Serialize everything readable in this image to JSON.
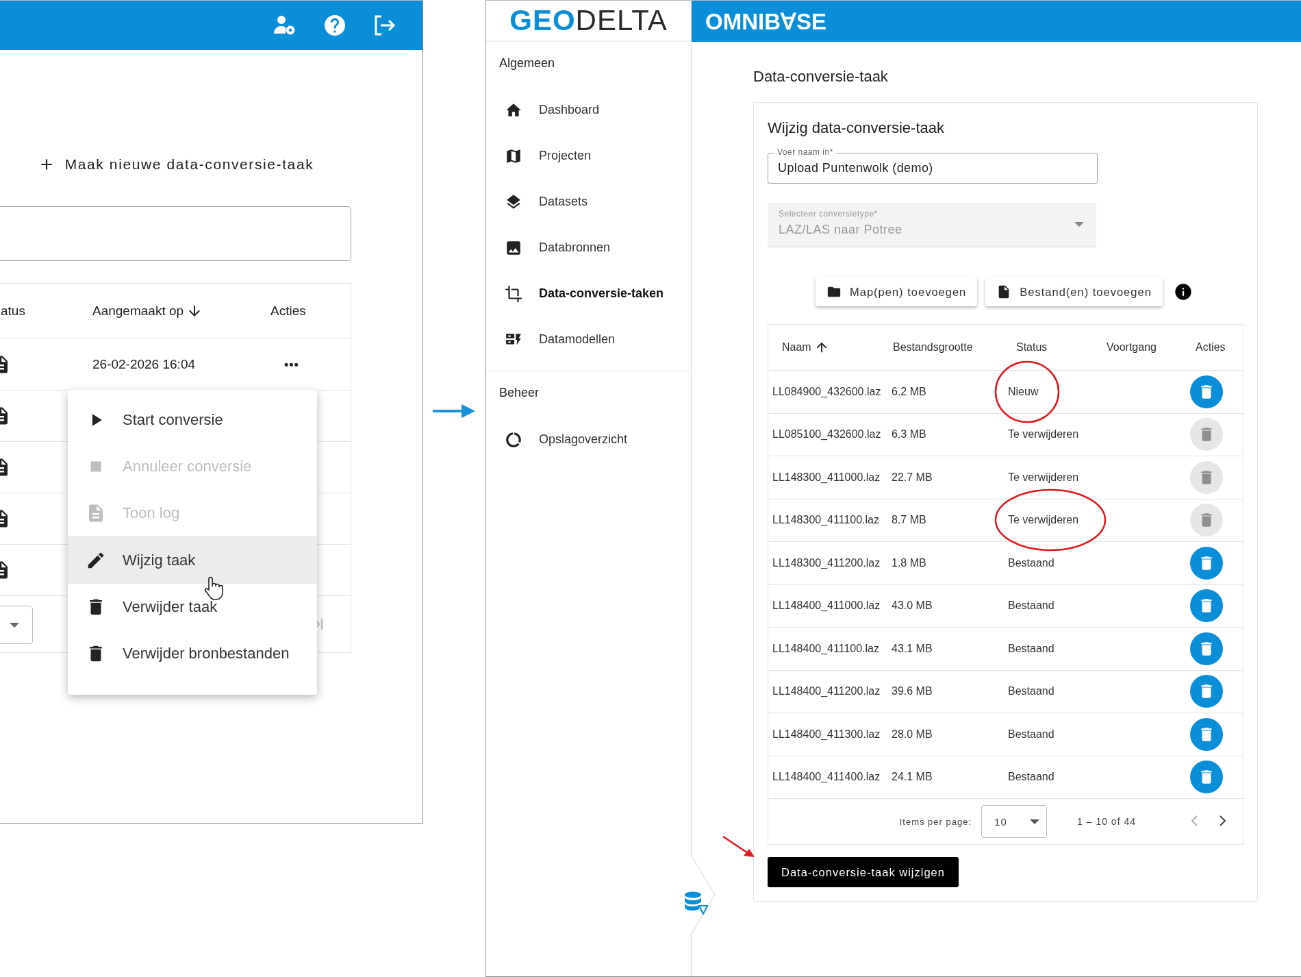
{
  "task_list_screen": {
    "new_task_button": "Maak nieuwe data-conversie-taak",
    "columns": [
      {
        "label": "atus"
      },
      {
        "label": "Aangemaakt op"
      },
      {
        "label": "Acties"
      }
    ],
    "rows": [
      {
        "kind": "full",
        "created": "26-02-2026 16:04",
        "actions": "•••"
      },
      {
        "kind": "covered"
      },
      {
        "kind": "covered"
      },
      {
        "kind": "covered"
      },
      {
        "kind": "covered"
      }
    ],
    "menu": {
      "items": [
        {
          "label": "Start conversie",
          "disabled": false,
          "hovered": false
        },
        {
          "label": "Annuleer conversie",
          "disabled": true,
          "hovered": false
        },
        {
          "label": "Toon log",
          "disabled": true,
          "hovered": false,
          "divider_after": true
        },
        {
          "label": "Wijzig taak",
          "disabled": false,
          "hovered": true
        },
        {
          "label": "Verwijder taak",
          "disabled": false,
          "hovered": false
        },
        {
          "label": "Verwijder bronbestanden",
          "disabled": false,
          "hovered": false
        }
      ]
    }
  },
  "edit_screen": {
    "brand": {
      "logo_part_1": "GEO",
      "logo_part_2": "DELTA",
      "product": "OMNIB∀SE"
    },
    "sidebar": {
      "sections": [
        {
          "title": "Algemeen",
          "items": [
            {
              "label": "Dashboard",
              "selected": false
            },
            {
              "label": "Projecten",
              "selected": false
            },
            {
              "label": "Datasets",
              "selected": false
            },
            {
              "label": "Databronnen",
              "selected": false
            },
            {
              "label": "Data-conversie-taken",
              "selected": true
            },
            {
              "label": "Datamodellen",
              "selected": false
            }
          ]
        },
        {
          "title": "Beheer",
          "items": [
            {
              "label": "Opslagoverzicht",
              "selected": false
            }
          ]
        }
      ]
    },
    "page_title": "Data-conversie-taak",
    "form": {
      "title": "Wijzig data-conversie-taak",
      "fields": [
        {
          "label": "Voer naam in*",
          "value": "Upload Puntenwolk (demo)",
          "disabled": false
        },
        {
          "label": "Selecteer conversietype*",
          "value": "LAZ/LAS naar Potree",
          "disabled": true
        }
      ],
      "buttons": [
        {
          "label": "Map(pen) toevoegen"
        },
        {
          "label": "Bestand(en) toevoegen"
        }
      ]
    },
    "files": {
      "columns": [
        {
          "label": "Naam"
        },
        {
          "label": "Bestandsgrootte"
        },
        {
          "label": "Status"
        },
        {
          "label": "Voortgang"
        },
        {
          "label": "Acties"
        }
      ],
      "rows": [
        {
          "name": "LL084900_432600.laz",
          "size": "6.2 MB",
          "status": "Nieuw",
          "delete_disabled": false,
          "circled": true
        },
        {
          "name": "LL085100_432600.laz",
          "size": "6.3 MB",
          "status": "Te verwijderen",
          "delete_disabled": true,
          "circled": false
        },
        {
          "name": "LL148300_411000.laz",
          "size": "22.7 MB",
          "status": "Te verwijderen",
          "delete_disabled": true,
          "circled": false
        },
        {
          "name": "LL148300_411100.laz",
          "size": "8.7 MB",
          "status": "Te verwijderen",
          "delete_disabled": true,
          "circled": true
        },
        {
          "name": "LL148300_411200.laz",
          "size": "1.8 MB",
          "status": "Bestaand",
          "delete_disabled": false,
          "circled": false
        },
        {
          "name": "LL148400_411000.laz",
          "size": "43.0 MB",
          "status": "Bestaand",
          "delete_disabled": false,
          "circled": false
        },
        {
          "name": "LL148400_411100.laz",
          "size": "43.1 MB",
          "status": "Bestaand",
          "delete_disabled": false,
          "circled": false
        },
        {
          "name": "LL148400_411200.laz",
          "size": "39.6 MB",
          "status": "Bestaand",
          "delete_disabled": false,
          "circled": false
        },
        {
          "name": "LL148400_411300.laz",
          "size": "28.0 MB",
          "status": "Bestaand",
          "delete_disabled": false,
          "circled": false
        },
        {
          "name": "LL148400_411400.laz",
          "size": "24.1 MB",
          "status": "Bestaand",
          "delete_disabled": false,
          "circled": false
        }
      ],
      "pagination": {
        "label": "Items per page:",
        "page_size": "10",
        "range": "1 – 10 of 44"
      }
    },
    "submit_button": "Data-conversie-taak wijzigen"
  }
}
